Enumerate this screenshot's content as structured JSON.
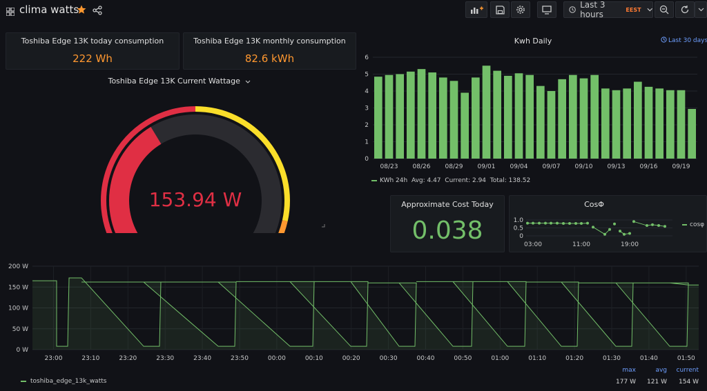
{
  "header": {
    "title": "clima watts",
    "time_range": "Last 3 hours",
    "timezone": "EEST"
  },
  "panels": {
    "today": {
      "title": "Toshiba Edge 13K today consumption",
      "value": "222 Wh",
      "color": "#ff9830"
    },
    "monthly": {
      "title": "Toshiba Edge 13K monthly consumption",
      "value": "82.6 kWh",
      "color": "#ff9830"
    },
    "gauge": {
      "title": "Toshiba Edge 13K Current Wattage",
      "value_text": "153.94 W",
      "value": 153.94,
      "max": 400,
      "color": "#e02f44"
    },
    "cost": {
      "title": "Approximate Cost Today",
      "value": "0.038",
      "color": "#73bf69"
    },
    "cosphi": {
      "title": "CosΦ",
      "legend": "cosφ"
    },
    "kwh": {
      "title": "Kwh Daily",
      "time_link": "Last 30 days",
      "legend": {
        "name": "KWh 24h",
        "avg": "Avg: 4.47",
        "current": "Current: 2.94",
        "total": "Total: 138.52"
      }
    },
    "watts": {
      "legend": {
        "name": "toshiba_edge_13k_watts",
        "max_label": "max",
        "avg_label": "avg",
        "current_label": "current",
        "max": "177 W",
        "avg": "121 W",
        "current": "154 W"
      }
    }
  },
  "chart_data": [
    {
      "type": "bar",
      "title": "Kwh Daily",
      "ylim": [
        0,
        6
      ],
      "y_ticks": [
        "0",
        "1",
        "2",
        "3",
        "4",
        "5",
        "6"
      ],
      "x_tick_labels": [
        "08/23",
        "08/26",
        "08/29",
        "09/01",
        "09/04",
        "09/07",
        "09/10",
        "09/13",
        "09/16",
        "09/19"
      ],
      "values": [
        4.85,
        4.95,
        5.0,
        5.15,
        5.3,
        5.1,
        4.8,
        4.6,
        3.9,
        4.8,
        5.5,
        5.2,
        4.9,
        5.05,
        4.95,
        4.3,
        4.0,
        4.7,
        4.95,
        4.75,
        4.95,
        4.15,
        4.05,
        4.15,
        4.55,
        4.25,
        4.15,
        4.05,
        4.05,
        2.94
      ],
      "color": "#73bf69"
    },
    {
      "type": "line",
      "title": "CosΦ",
      "ylim": [
        0,
        1
      ],
      "y_ticks": [
        "1.0",
        "0.5",
        "0"
      ],
      "x_tick_labels": [
        "03:00",
        "11:00",
        "19:00"
      ],
      "color": "#73bf69"
    },
    {
      "type": "area",
      "y_ticks": [
        "0 W",
        "50 W",
        "100 W",
        "150 W",
        "200 W"
      ],
      "ylim": [
        0,
        200
      ],
      "x_tick_labels": [
        "23:00",
        "23:10",
        "23:20",
        "23:30",
        "23:40",
        "23:50",
        "00:00",
        "00:10",
        "00:20",
        "00:30",
        "00:40",
        "00:50",
        "01:00",
        "01:10",
        "01:20",
        "01:30",
        "01:40",
        "01:50"
      ],
      "series": [
        {
          "name": "toshiba_edge_13k_watts"
        }
      ],
      "color": "#73bf69"
    }
  ]
}
